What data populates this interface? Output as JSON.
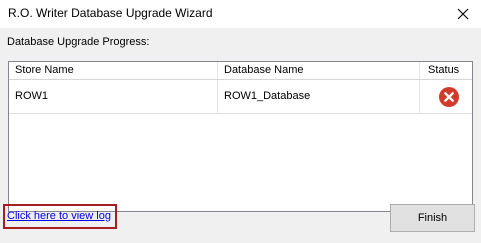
{
  "window": {
    "title": "R.O. Writer Database Upgrade Wizard"
  },
  "progress_label": "Database Upgrade Progress:",
  "grid": {
    "columns": [
      "Store Name",
      "Database Name",
      "Status"
    ],
    "rows": [
      {
        "store": "ROW1",
        "database": "ROW1_Database",
        "status": "error-icon"
      }
    ]
  },
  "footer": {
    "log_link": "Click here to view log",
    "finish_label": "Finish"
  },
  "colors": {
    "error": "#d23a2a",
    "link": "#0000ee",
    "highlight_border": "#a41e22"
  }
}
